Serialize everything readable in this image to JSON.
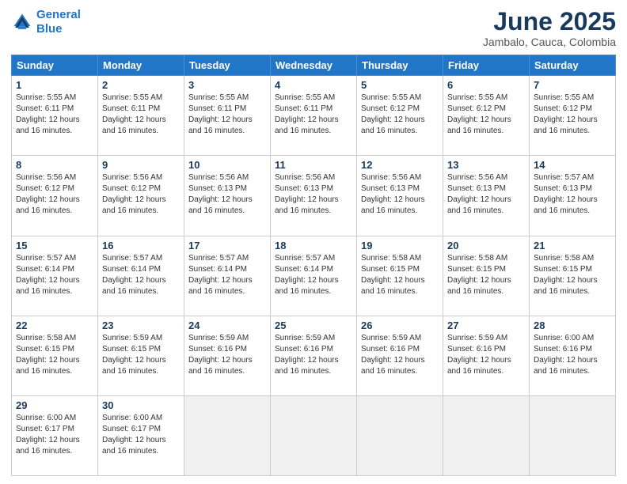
{
  "logo": {
    "line1": "General",
    "line2": "Blue"
  },
  "title": "June 2025",
  "location": "Jambalo, Cauca, Colombia",
  "days_of_week": [
    "Sunday",
    "Monday",
    "Tuesday",
    "Wednesday",
    "Thursday",
    "Friday",
    "Saturday"
  ],
  "weeks": [
    [
      {
        "day": "1",
        "sunrise": "5:55 AM",
        "sunset": "6:11 PM",
        "daylight": "12 hours and 16 minutes."
      },
      {
        "day": "2",
        "sunrise": "5:55 AM",
        "sunset": "6:11 PM",
        "daylight": "12 hours and 16 minutes."
      },
      {
        "day": "3",
        "sunrise": "5:55 AM",
        "sunset": "6:11 PM",
        "daylight": "12 hours and 16 minutes."
      },
      {
        "day": "4",
        "sunrise": "5:55 AM",
        "sunset": "6:11 PM",
        "daylight": "12 hours and 16 minutes."
      },
      {
        "day": "5",
        "sunrise": "5:55 AM",
        "sunset": "6:12 PM",
        "daylight": "12 hours and 16 minutes."
      },
      {
        "day": "6",
        "sunrise": "5:55 AM",
        "sunset": "6:12 PM",
        "daylight": "12 hours and 16 minutes."
      },
      {
        "day": "7",
        "sunrise": "5:55 AM",
        "sunset": "6:12 PM",
        "daylight": "12 hours and 16 minutes."
      }
    ],
    [
      {
        "day": "8",
        "sunrise": "5:56 AM",
        "sunset": "6:12 PM",
        "daylight": "12 hours and 16 minutes."
      },
      {
        "day": "9",
        "sunrise": "5:56 AM",
        "sunset": "6:12 PM",
        "daylight": "12 hours and 16 minutes."
      },
      {
        "day": "10",
        "sunrise": "5:56 AM",
        "sunset": "6:13 PM",
        "daylight": "12 hours and 16 minutes."
      },
      {
        "day": "11",
        "sunrise": "5:56 AM",
        "sunset": "6:13 PM",
        "daylight": "12 hours and 16 minutes."
      },
      {
        "day": "12",
        "sunrise": "5:56 AM",
        "sunset": "6:13 PM",
        "daylight": "12 hours and 16 minutes."
      },
      {
        "day": "13",
        "sunrise": "5:56 AM",
        "sunset": "6:13 PM",
        "daylight": "12 hours and 16 minutes."
      },
      {
        "day": "14",
        "sunrise": "5:57 AM",
        "sunset": "6:13 PM",
        "daylight": "12 hours and 16 minutes."
      }
    ],
    [
      {
        "day": "15",
        "sunrise": "5:57 AM",
        "sunset": "6:14 PM",
        "daylight": "12 hours and 16 minutes."
      },
      {
        "day": "16",
        "sunrise": "5:57 AM",
        "sunset": "6:14 PM",
        "daylight": "12 hours and 16 minutes."
      },
      {
        "day": "17",
        "sunrise": "5:57 AM",
        "sunset": "6:14 PM",
        "daylight": "12 hours and 16 minutes."
      },
      {
        "day": "18",
        "sunrise": "5:57 AM",
        "sunset": "6:14 PM",
        "daylight": "12 hours and 16 minutes."
      },
      {
        "day": "19",
        "sunrise": "5:58 AM",
        "sunset": "6:15 PM",
        "daylight": "12 hours and 16 minutes."
      },
      {
        "day": "20",
        "sunrise": "5:58 AM",
        "sunset": "6:15 PM",
        "daylight": "12 hours and 16 minutes."
      },
      {
        "day": "21",
        "sunrise": "5:58 AM",
        "sunset": "6:15 PM",
        "daylight": "12 hours and 16 minutes."
      }
    ],
    [
      {
        "day": "22",
        "sunrise": "5:58 AM",
        "sunset": "6:15 PM",
        "daylight": "12 hours and 16 minutes."
      },
      {
        "day": "23",
        "sunrise": "5:59 AM",
        "sunset": "6:15 PM",
        "daylight": "12 hours and 16 minutes."
      },
      {
        "day": "24",
        "sunrise": "5:59 AM",
        "sunset": "6:16 PM",
        "daylight": "12 hours and 16 minutes."
      },
      {
        "day": "25",
        "sunrise": "5:59 AM",
        "sunset": "6:16 PM",
        "daylight": "12 hours and 16 minutes."
      },
      {
        "day": "26",
        "sunrise": "5:59 AM",
        "sunset": "6:16 PM",
        "daylight": "12 hours and 16 minutes."
      },
      {
        "day": "27",
        "sunrise": "5:59 AM",
        "sunset": "6:16 PM",
        "daylight": "12 hours and 16 minutes."
      },
      {
        "day": "28",
        "sunrise": "6:00 AM",
        "sunset": "6:16 PM",
        "daylight": "12 hours and 16 minutes."
      }
    ],
    [
      {
        "day": "29",
        "sunrise": "6:00 AM",
        "sunset": "6:17 PM",
        "daylight": "12 hours and 16 minutes."
      },
      {
        "day": "30",
        "sunrise": "6:00 AM",
        "sunset": "6:17 PM",
        "daylight": "12 hours and 16 minutes."
      },
      null,
      null,
      null,
      null,
      null
    ]
  ],
  "labels": {
    "sunrise": "Sunrise:",
    "sunset": "Sunset:",
    "daylight": "Daylight:"
  }
}
